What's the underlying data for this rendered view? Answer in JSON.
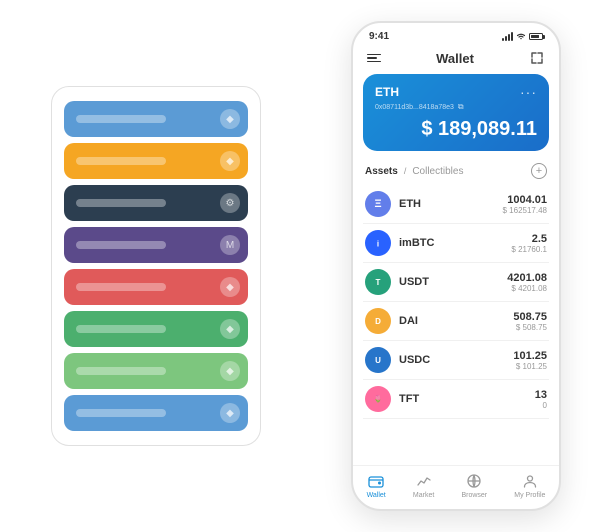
{
  "app": {
    "title": "Wallet",
    "status_time": "9:41"
  },
  "card_stack": {
    "cards": [
      {
        "color": "blue",
        "label": "",
        "icon": "◆"
      },
      {
        "color": "yellow",
        "label": "",
        "icon": "◆"
      },
      {
        "color": "dark",
        "label": "",
        "icon": "⚙"
      },
      {
        "color": "purple",
        "label": "",
        "icon": "M"
      },
      {
        "color": "red",
        "label": "",
        "icon": "◆"
      },
      {
        "color": "green",
        "label": "",
        "icon": "◆"
      },
      {
        "color": "light-green",
        "label": "",
        "icon": "◆"
      },
      {
        "color": "light-blue",
        "label": "",
        "icon": "◆"
      }
    ]
  },
  "phone": {
    "status_time": "9:41",
    "header_title": "Wallet",
    "eth_card": {
      "symbol": "ETH",
      "address": "0x08711d3b...8418a78e3",
      "copy_icon": "⧉",
      "dots": "···",
      "balance_label": "$",
      "balance": "189,089.11"
    },
    "assets_tab": "Assets",
    "collectibles_tab": "Collectibles",
    "add_icon": "+",
    "assets": [
      {
        "name": "ETH",
        "icon_bg": "#627EEA",
        "icon_text": "Ξ",
        "amount": "1004.01",
        "usd": "$ 162517.48"
      },
      {
        "name": "imBTC",
        "icon_bg": "#2962FF",
        "icon_text": "i",
        "amount": "2.5",
        "usd": "$ 21760.1"
      },
      {
        "name": "USDT",
        "icon_bg": "#26A17B",
        "icon_text": "T",
        "amount": "4201.08",
        "usd": "$ 4201.08"
      },
      {
        "name": "DAI",
        "icon_bg": "#F5AC37",
        "icon_text": "D",
        "amount": "508.75",
        "usd": "$ 508.75"
      },
      {
        "name": "USDC",
        "icon_bg": "#2775CA",
        "icon_text": "U",
        "amount": "101.25",
        "usd": "$ 101.25"
      },
      {
        "name": "TFT",
        "icon_bg": "#FF6B9D",
        "icon_text": "🌷",
        "amount": "13",
        "usd": "0"
      }
    ],
    "nav_items": [
      {
        "label": "Wallet",
        "active": true
      },
      {
        "label": "Market",
        "active": false
      },
      {
        "label": "Browser",
        "active": false
      },
      {
        "label": "My Profile",
        "active": false
      }
    ]
  }
}
